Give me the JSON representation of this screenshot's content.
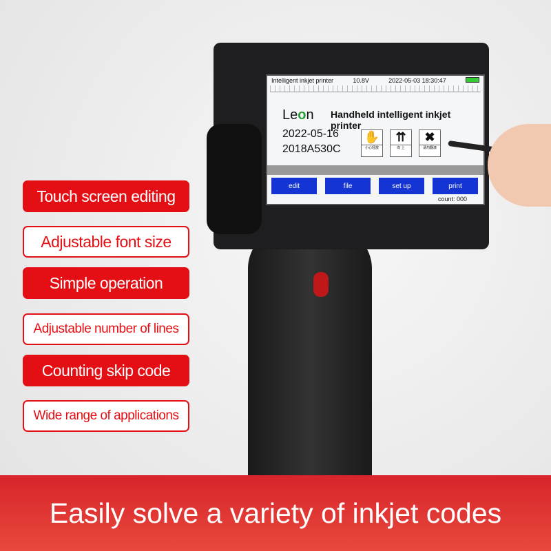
{
  "features": [
    "Touch screen editing",
    "Adjustable font size",
    "Simple operation",
    "Adjustable number of lines",
    "Counting skip code",
    "Wide range of applications"
  ],
  "screen": {
    "title": "Intelligent inkjet printer",
    "voltage": "10.8V",
    "datetime": "2022-05-03 18:30:47",
    "logo_pre": "Le",
    "logo_o": "o",
    "logo_post": "n",
    "headline": "Handheld intelligent inkjet printer",
    "date": "2022-05-16",
    "code": "2018A530C",
    "symbols": [
      {
        "glyph": "✋",
        "label": "小心轻放"
      },
      {
        "glyph": "⇈",
        "label": "向 上"
      },
      {
        "glyph": "✖",
        "label": "请勿翻滚"
      }
    ],
    "buttons": [
      "edit",
      "file",
      "set up",
      "print"
    ],
    "count": "count: 000"
  },
  "banner": "Easily solve a variety of inkjet codes",
  "colors": {
    "accent": "#e30f14",
    "button": "#1434d4"
  }
}
